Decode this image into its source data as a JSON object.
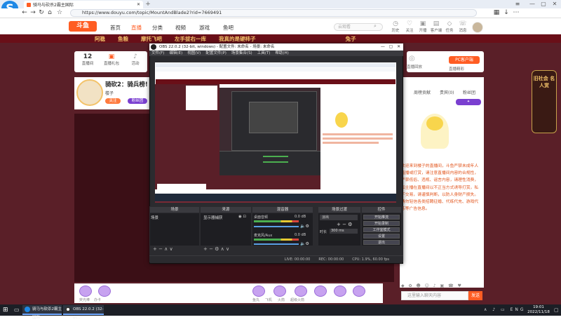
{
  "browser": {
    "logo": "S",
    "tab_title": "骑马与砍杀2霸主国际",
    "new_tab": "+",
    "url": "https://www.douyu.com/topic/MountAndBlade2?rid=7669491",
    "url_host_label": "全"
  },
  "site": {
    "logo": "斗鱼",
    "nav": [
      "首页",
      "直播",
      "分类",
      "视频",
      "游戏",
      "鱼吧"
    ],
    "search_placeholder": "云观看",
    "header_icons": [
      {
        "icon": "history-icon",
        "label": "历史"
      },
      {
        "icon": "follow-icon",
        "label": "关注"
      },
      {
        "icon": "gift-icon",
        "label": "开播"
      },
      {
        "icon": "app-icon",
        "label": "客户端"
      },
      {
        "icon": "task-icon",
        "label": "任务"
      },
      {
        "icon": "message-icon",
        "label": "消息"
      }
    ],
    "banner": [
      "阿稳",
      "鱼粮",
      "摩托飞吧",
      "左手拔右一库",
      "我真的是硬柿子",
      "兔子"
    ],
    "room_stats": [
      {
        "value": "12",
        "label": "直播间"
      },
      {
        "value": "",
        "label": "直播礼包"
      },
      {
        "value": "",
        "label": "活动"
      }
    ],
    "room_title": "骑砍2：骑兵榜!",
    "streamer_name": "楼子",
    "follow_label": "关注",
    "report_label": "粉丝团",
    "pc_download": "PC客户端",
    "right_stats": [
      {
        "label": "直播回放"
      },
      {
        "label": "直播精彩"
      }
    ],
    "chat_tabs": [
      "周榜贡献",
      "贵宾(0)",
      "粉丝团"
    ],
    "chat_notice": "欢迎来到楼子的直播间，斗鱼严禁未成年人直播或打赏，请注意直播间内容的合规性，严禁低俗、违规、谣言内容，请理性消费，如主播在直播间以不正当方式诱导打赏，私下交易，请谨慎判断，以防人身财产损失。请勿轻信各类招聘征婚、代练代充、游戏代练等广告信息。",
    "chat_input_placeholder": "这里输入聊天内容",
    "send_label": "发送",
    "chat_tools": "◆ ✿ ☻ ☺ ♪ ▣ ☎ ♥",
    "right_badge": "旧社会 名人赏",
    "gifts": [
      "荧光棒",
      "办卡",
      "鱼丸",
      "飞机",
      "火箭",
      "超级火箭"
    ]
  },
  "obs": {
    "title": "OBS 22.0.2 (32-bit, windows) - 配置文件: 未命名 - 场景: 未命名",
    "menu": [
      "文件(F)",
      "编辑(E)",
      "视图(V)",
      "配置文件(P)",
      "场景集合(S)",
      "工具(T)",
      "帮助(H)"
    ],
    "docks": {
      "scenes": "场景",
      "sources": "来源",
      "mixer": "混音器",
      "transitions": "场景过渡",
      "controls": "控件"
    },
    "scene_item": "场景",
    "source_item": "显示器捕获",
    "mixer_tracks": [
      {
        "name": "桌面音频",
        "db": "0.0 dB"
      },
      {
        "name": "麦克风/Aux",
        "db": "0.0 dB"
      }
    ],
    "transition": "淡出",
    "duration_label": "时长",
    "duration_value": "300 ms",
    "controls": [
      "开始推流",
      "开始录制",
      "工作室模式",
      "设置",
      "退出"
    ],
    "status": [
      "LIVE: 00:00:00",
      "REC: 00:00:00",
      "CPU: 1.9%, 60.00 fps"
    ]
  },
  "taskbar": {
    "start": "⊞",
    "tasks": [
      "骑马与砍杀2霸主国际",
      "OBS 22.0.2 (32-bi..."
    ],
    "tray": "∧ ♪ ▭ ENG",
    "time": "19:01",
    "date": "2022/11/18"
  },
  "colors": {
    "accent": "#ff5d23",
    "page_bg": "#5a1f28",
    "obs_bg": "#2b2b2f"
  }
}
